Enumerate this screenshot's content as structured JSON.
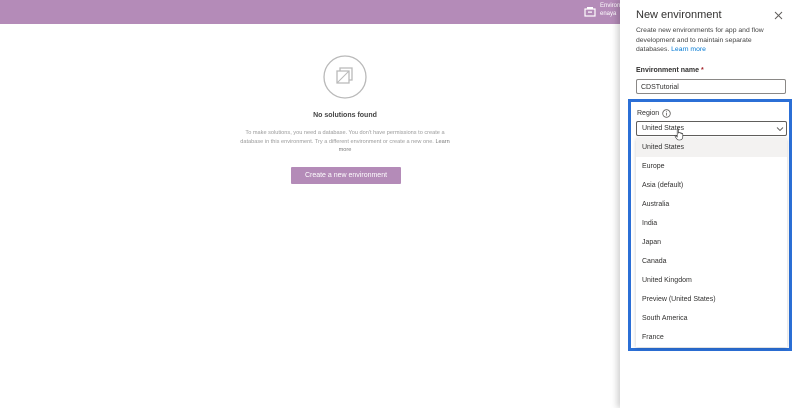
{
  "topbar": {
    "env_line1": "Environ",
    "env_line2": "enaya"
  },
  "main": {
    "empty_title": "No solutions found",
    "empty_desc": "To make solutions, you need a database. You don't have permissions to create a database in this environment. Try a different environment or create a new one.",
    "learn_more": "Learn more",
    "create_button": "Create a new environment"
  },
  "panel": {
    "title": "New environment",
    "description": "Create new environments for app and flow development and to maintain separate databases.",
    "learn_more": "Learn more",
    "name_label": "Environment name",
    "required_mark": "*",
    "name_value": "CDSTutorial",
    "region_label": "Region",
    "region_selected": "United States",
    "region_options": [
      "United States",
      "Europe",
      "Asia (default)",
      "Australia",
      "India",
      "Japan",
      "Canada",
      "United Kingdom",
      "Preview (United States)",
      "South America",
      "France"
    ]
  },
  "colors": {
    "topbar": "#b48bb8",
    "button": "#b48bb8",
    "highlight": "#2b6fd6",
    "link": "#0078d4"
  },
  "icons": {
    "env": "environment-icon",
    "empty": "empty-solutions-icon",
    "close": "close-icon",
    "info": "info-icon",
    "chevron": "chevron-down-icon",
    "cursor": "hand-cursor-icon"
  }
}
